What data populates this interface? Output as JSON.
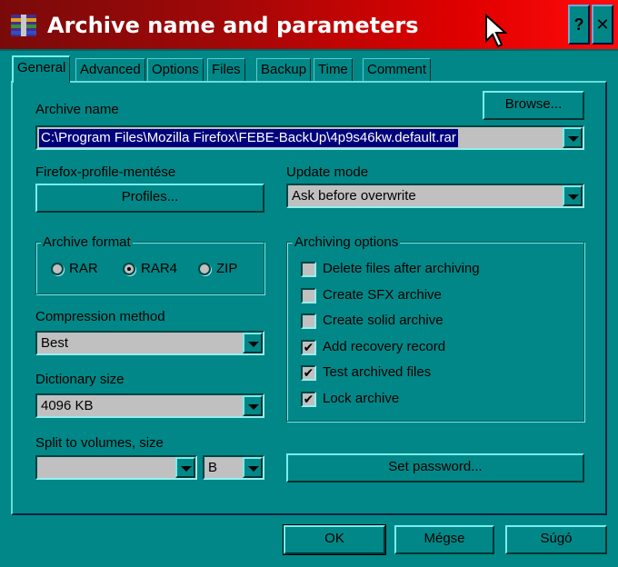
{
  "window": {
    "title": "Archive name and parameters",
    "help_glyph": "?",
    "close_glyph": "✕"
  },
  "tabs": [
    "General",
    "Advanced",
    "Options",
    "Files",
    "Backup",
    "Time",
    "Comment"
  ],
  "archive_name": {
    "label": "Archive name",
    "value": "C:\\Program Files\\Mozilla Firefox\\FEBE-BackUp\\4p9s46kw.default.rar",
    "browse_label": "Browse..."
  },
  "profile": {
    "label": "Firefox-profile-mentése",
    "button_label": "Profiles..."
  },
  "update_mode": {
    "label": "Update mode",
    "value": "Ask before overwrite"
  },
  "archive_format": {
    "legend": "Archive format",
    "options": [
      "RAR",
      "RAR4",
      "ZIP"
    ],
    "selected": "RAR4"
  },
  "archiving_options": {
    "legend": "Archiving options",
    "items": [
      {
        "label": "Delete files after archiving",
        "checked": false
      },
      {
        "label": "Create SFX archive",
        "checked": false
      },
      {
        "label": "Create solid archive",
        "checked": false
      },
      {
        "label": "Add recovery record",
        "checked": true
      },
      {
        "label": "Test archived files",
        "checked": true
      },
      {
        "label": "Lock archive",
        "checked": true
      }
    ]
  },
  "compression": {
    "label": "Compression method",
    "value": "Best"
  },
  "dictionary": {
    "label": "Dictionary size",
    "value": "4096 KB"
  },
  "split": {
    "label": "Split to volumes, size",
    "value": "",
    "unit": "B"
  },
  "password_button": "Set password...",
  "footer": {
    "ok": "OK",
    "cancel": "Mégse",
    "help": "Súgó"
  },
  "check_glyph": "✔",
  "colors": {
    "face": "#018787",
    "title_start": "#7a0a0a",
    "title_end": "#ff0b0b",
    "field": "#c0c0c0",
    "selection": "#00007c"
  }
}
